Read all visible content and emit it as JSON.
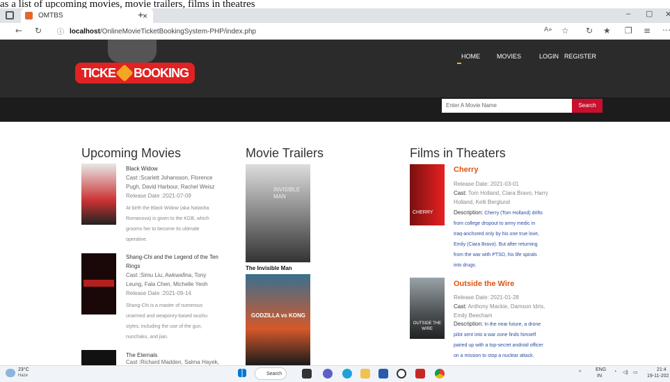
{
  "caption": "as a list of upcoming movies, movie trailers, films in theatres",
  "browser": {
    "tab_title": "OMTBS",
    "tab_close": "×",
    "new_tab": "+",
    "url_host": "localhost",
    "url_path": "/OnlineMovieTicketBookingSystem-PHP/index.php",
    "win_min": "–",
    "win_max": "▢",
    "win_close": "✕"
  },
  "site": {
    "logo_text_left": "TICKE",
    "logo_text_right": "BOOKING",
    "nav": [
      "HOME",
      "MOVIES",
      "LOGIN",
      "REGISTER"
    ],
    "search_placeholder": "Enter A Movie Name",
    "search_button": "Search"
  },
  "upcoming": {
    "heading": "Upcoming Movies",
    "items": [
      {
        "title": "Black Widow",
        "cast": "Cast :Scarlett Johansson, Florence Pugh, David Harbour, Rachel Weisz",
        "release": "Release Date :2021-07-09",
        "description": "At birth the Black Widow (aka Natasha Romanova) is given to the KGB, which grooms her to become its ultimate operative."
      },
      {
        "title": "Shang-Chi and the Legend of the Ten Rings",
        "cast": "Cast :Simu Liu, Awkwafina, Tony Leung, Fala Chen, Michelle Yeoh",
        "release": "Release Date :2021-09-14",
        "description": "Shang-Chi is a master of numerous unarmed and weaponry-based wushu styles, including the use of the gun, nunchaku, and jian."
      },
      {
        "title": "The Eternals",
        "cast": "Cast :Richard Madden, Salma Hayek,"
      }
    ]
  },
  "trailers": {
    "heading": "Movie Trailers",
    "items": [
      {
        "title": "The Invisible Man",
        "poster_text": "INVISIBLE MAN"
      },
      {
        "title": "",
        "poster_text": "GODZILLA vs KONG"
      }
    ]
  },
  "theaters": {
    "heading": "Films in Theaters",
    "items": [
      {
        "title": "Cherry",
        "release": "Release Date: 2021-03-01",
        "cast_label": "Cast:",
        "cast": "Tom Holland, Ciara Bravo, Harry Holland, Kelli Berglund",
        "desc_label": "Description:",
        "description": "Cherry (Tom Holland) drifts from college dropout to army medic in Iraq-anchored only by his one true love, Emily (Ciara Bravo). But after returning from the war with PTSD, his life spirals into drugs.",
        "poster_text": "CHERRY"
      },
      {
        "title": "Outside the Wire",
        "release": "Release Date: 2021-01-28",
        "cast_label": "Cast:",
        "cast": "Anthony Mackie, Damson Idris, Emily Beecham",
        "desc_label": "Description:",
        "description": "In the near future, a drone pilot sent into a war zone finds himself paired up with a top-secret android officer on a mission to stop a nuclear attack.",
        "poster_text": "OUTSIDE THE WIRE"
      }
    ]
  },
  "taskbar": {
    "weather_temp": "23°C",
    "weather_desc": "Haze",
    "search": "Search",
    "lang": "ENG",
    "region": "IN",
    "time": "21:4",
    "date": "19-11-202"
  },
  "colors": {
    "header_bg": "#2b2b2b",
    "accent_red": "#c8102e",
    "film_title": "#e0540f"
  }
}
